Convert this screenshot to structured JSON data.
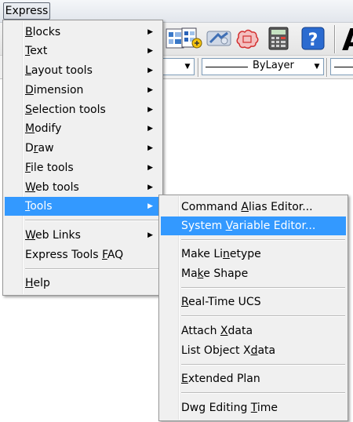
{
  "menubar": {
    "express_label": "Express"
  },
  "toolbar": {
    "icons": [
      "image-manager-icon",
      "hyperlink-icon",
      "break-icon",
      "revcloud-icon",
      "calculator-icon",
      "help-icon"
    ],
    "text_style_glyph": "A"
  },
  "propbar": {
    "linetype_value": "ByLayer"
  },
  "express_menu": {
    "items": [
      {
        "pre": "",
        "u": "B",
        "post": "locks",
        "submenu": true
      },
      {
        "pre": "",
        "u": "T",
        "post": "ext",
        "submenu": true
      },
      {
        "pre": "",
        "u": "L",
        "post": "ayout tools",
        "submenu": true
      },
      {
        "pre": "",
        "u": "D",
        "post": "imension",
        "submenu": true
      },
      {
        "pre": "",
        "u": "S",
        "post": "election tools",
        "submenu": true
      },
      {
        "pre": "",
        "u": "M",
        "post": "odify",
        "submenu": true
      },
      {
        "pre": "D",
        "u": "r",
        "post": "aw",
        "submenu": true
      },
      {
        "pre": "",
        "u": "F",
        "post": "ile tools",
        "submenu": true
      },
      {
        "pre": "",
        "u": "W",
        "post": "eb tools",
        "submenu": true
      },
      {
        "pre": "",
        "u": "T",
        "post": "ools",
        "submenu": true
      },
      {
        "pre": "",
        "u": "W",
        "post": "eb Links",
        "submenu": true
      },
      {
        "pre": "Express Tools ",
        "u": "F",
        "post": "AQ",
        "submenu": false
      },
      {
        "pre": "",
        "u": "H",
        "post": "elp",
        "submenu": false
      }
    ],
    "submenu_arrow": "▶"
  },
  "tools_menu": {
    "items": [
      {
        "pre": "Command ",
        "u": "A",
        "post": "lias Editor..."
      },
      {
        "pre": "System ",
        "u": "V",
        "post": "ariable Editor..."
      },
      {
        "pre": "Make Li",
        "u": "n",
        "post": "etype"
      },
      {
        "pre": "Ma",
        "u": "k",
        "post": "e Shape"
      },
      {
        "pre": "",
        "u": "R",
        "post": "eal-Time UCS"
      },
      {
        "pre": "Attach ",
        "u": "X",
        "post": "data"
      },
      {
        "pre": "List Object X",
        "u": "d",
        "post": "ata"
      },
      {
        "pre": "",
        "u": "E",
        "post": "xtended Plan"
      },
      {
        "pre": "Dwg Editing ",
        "u": "T",
        "post": "ime"
      }
    ]
  }
}
